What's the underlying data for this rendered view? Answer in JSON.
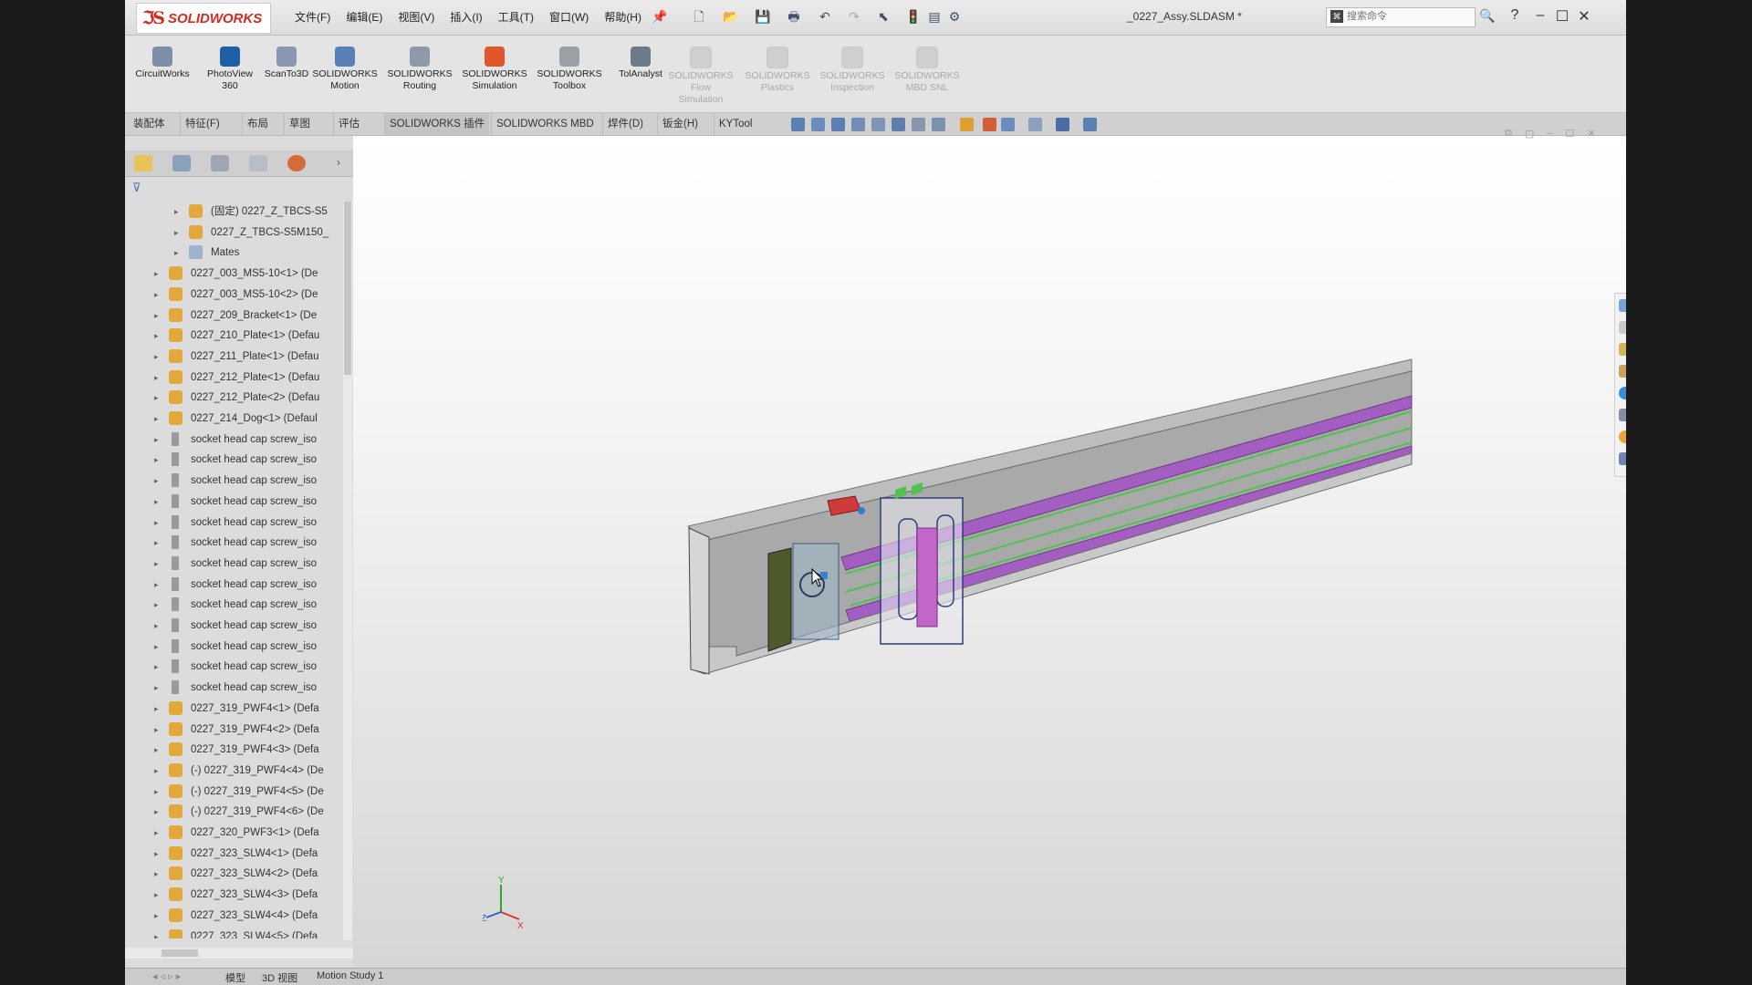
{
  "app": {
    "logo_text": "SOLIDWORKS",
    "document_title": "_0227_Assy.SLDASM *",
    "menu": [
      "文件(F)",
      "编辑(E)",
      "视图(V)",
      "插入(I)",
      "工具(T)",
      "窗口(W)",
      "帮助(H)"
    ],
    "search": {
      "placeholder": "搜索命令"
    },
    "help_glyph": "?"
  },
  "ribbon": {
    "buttons": [
      {
        "line1": "CircuitWorks",
        "line2": "",
        "line3": "",
        "enabled": true,
        "icon": "circuitworks-icon",
        "color": "#7c8ea8"
      },
      {
        "line1": "PhotoView",
        "line2": "360",
        "line3": "",
        "enabled": true,
        "icon": "photoview-icon",
        "color": "#1f5fa8"
      },
      {
        "line1": "ScanTo3D",
        "line2": "",
        "line3": "",
        "enabled": true,
        "icon": "scanto3d-icon",
        "color": "#8a96b4"
      },
      {
        "line1": "SOLIDWORKS",
        "line2": "Motion",
        "line3": "",
        "enabled": true,
        "icon": "motion-icon",
        "color": "#5b7fb8"
      },
      {
        "line1": "SOLIDWORKS",
        "line2": "Routing",
        "line3": "",
        "enabled": true,
        "icon": "routing-icon",
        "color": "#8f9aa8"
      },
      {
        "line1": "SOLIDWORKS",
        "line2": "Simulation",
        "line3": "",
        "enabled": true,
        "icon": "simulation-icon",
        "color": "#e0582a"
      },
      {
        "line1": "SOLIDWORKS",
        "line2": "Toolbox",
        "line3": "",
        "enabled": true,
        "icon": "toolbox-icon",
        "color": "#9aa0a6"
      },
      {
        "line1": "TolAnalyst",
        "line2": "",
        "line3": "",
        "enabled": true,
        "icon": "tolanalyst-icon",
        "color": "#6c7a8a"
      },
      {
        "line1": "SOLIDWORKS",
        "line2": "Flow",
        "line3": "Simulation",
        "enabled": false,
        "icon": "flow-simulation-icon",
        "color": "#cfcfcf"
      },
      {
        "line1": "SOLIDWORKS",
        "line2": "Plastics",
        "line3": "",
        "enabled": false,
        "icon": "plastics-icon",
        "color": "#cfcfcf"
      },
      {
        "line1": "SOLIDWORKS",
        "line2": "Inspection",
        "line3": "",
        "enabled": false,
        "icon": "inspection-icon",
        "color": "#cfcfcf"
      },
      {
        "line1": "SOLIDWORKS",
        "line2": "MBD SNL",
        "line3": "",
        "enabled": false,
        "icon": "mbd-snl-icon",
        "color": "#cfcfcf"
      }
    ]
  },
  "command_tabs": [
    "装配体",
    "特征(F)",
    "布局",
    "草图",
    "评估",
    "SOLIDWORKS 插件",
    "SOLIDWORKS MBD",
    "焊件(D)",
    "钣金(H)",
    "KYTool"
  ],
  "tree": {
    "rows": [
      {
        "level": 2,
        "icon": "part",
        "text": "(固定) 0227_Z_TBCS-S5"
      },
      {
        "level": 2,
        "icon": "part",
        "text": "0227_Z_TBCS-S5M150_"
      },
      {
        "level": 2,
        "icon": "mates",
        "text": "Mates"
      },
      {
        "level": 1,
        "icon": "part",
        "text": "0227_003_MS5-10<1> (De"
      },
      {
        "level": 1,
        "icon": "part",
        "text": "0227_003_MS5-10<2> (De"
      },
      {
        "level": 1,
        "icon": "part",
        "text": "0227_209_Bracket<1> (De"
      },
      {
        "level": 1,
        "icon": "part",
        "text": "0227_210_Plate<1> (Defau"
      },
      {
        "level": 1,
        "icon": "part",
        "text": "0227_211_Plate<1> (Defau"
      },
      {
        "level": 1,
        "icon": "part",
        "text": "0227_212_Plate<1> (Defau"
      },
      {
        "level": 1,
        "icon": "part",
        "text": "0227_212_Plate<2> (Defau"
      },
      {
        "level": 1,
        "icon": "part",
        "text": "0227_214_Dog<1> (Defaul"
      },
      {
        "level": 1,
        "icon": "screw",
        "text": "socket head cap screw_iso"
      },
      {
        "level": 1,
        "icon": "screw",
        "text": "socket head cap screw_iso"
      },
      {
        "level": 1,
        "icon": "screw",
        "text": "socket head cap screw_iso"
      },
      {
        "level": 1,
        "icon": "screw",
        "text": "socket head cap screw_iso"
      },
      {
        "level": 1,
        "icon": "screw",
        "text": "socket head cap screw_iso"
      },
      {
        "level": 1,
        "icon": "screw",
        "text": "socket head cap screw_iso"
      },
      {
        "level": 1,
        "icon": "screw",
        "text": "socket head cap screw_iso"
      },
      {
        "level": 1,
        "icon": "screw",
        "text": "socket head cap screw_iso"
      },
      {
        "level": 1,
        "icon": "screw",
        "text": "socket head cap screw_iso"
      },
      {
        "level": 1,
        "icon": "screw",
        "text": "socket head cap screw_iso"
      },
      {
        "level": 1,
        "icon": "screw",
        "text": "socket head cap screw_iso"
      },
      {
        "level": 1,
        "icon": "screw",
        "text": "socket head cap screw_iso"
      },
      {
        "level": 1,
        "icon": "screw",
        "text": "socket head cap screw_iso"
      },
      {
        "level": 1,
        "icon": "part",
        "text": "0227_319_PWF4<1> (Defa"
      },
      {
        "level": 1,
        "icon": "part",
        "text": "0227_319_PWF4<2> (Defa"
      },
      {
        "level": 1,
        "icon": "part",
        "text": "0227_319_PWF4<3> (Defa"
      },
      {
        "level": 1,
        "icon": "part",
        "text": "(-) 0227_319_PWF4<4> (De"
      },
      {
        "level": 1,
        "icon": "part",
        "text": "(-) 0227_319_PWF4<5> (De"
      },
      {
        "level": 1,
        "icon": "part",
        "text": "(-) 0227_319_PWF4<6> (De"
      },
      {
        "level": 1,
        "icon": "part",
        "text": "0227_320_PWF3<1> (Defa"
      },
      {
        "level": 1,
        "icon": "part",
        "text": "0227_323_SLW4<1> (Defa"
      },
      {
        "level": 1,
        "icon": "part",
        "text": "0227_323_SLW4<2> (Defa"
      },
      {
        "level": 1,
        "icon": "part",
        "text": "0227_323_SLW4<3> (Defa"
      },
      {
        "level": 1,
        "icon": "part",
        "text": "0227_323_SLW4<4> (Defa"
      },
      {
        "level": 1,
        "icon": "part",
        "text": "0227_323_SLW4<5> (Defa"
      }
    ]
  },
  "bottom_tabs": [
    "模型",
    "3D 视图",
    "Motion Study 1"
  ],
  "triad": {
    "x": "X",
    "y": "Y",
    "z": "Z"
  },
  "colors": {
    "brand_red": "#d52b1e",
    "part_icon": "#e3a83a",
    "rail_purple": "#a35ec2",
    "rail_green": "#4fc24f"
  }
}
